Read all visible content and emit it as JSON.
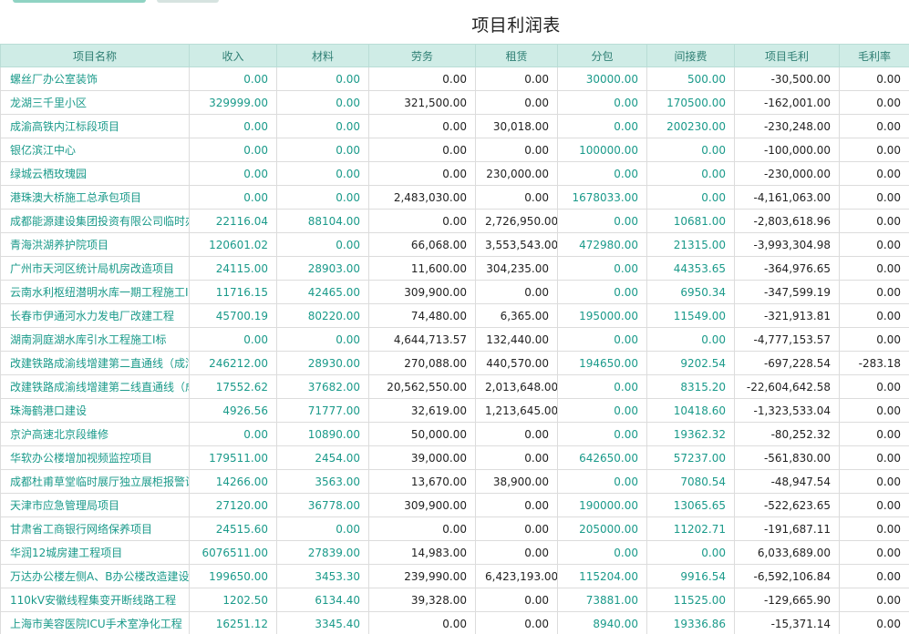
{
  "report": {
    "title": "项目利润表"
  },
  "columns": [
    "项目名称",
    "收入",
    "材料",
    "劳务",
    "租赁",
    "分包",
    "间接费",
    "项目毛利",
    "毛利率"
  ],
  "rows": [
    [
      "螺丝厂办公室装饰",
      "0.00",
      "0.00",
      "0.00",
      "0.00",
      "30000.00",
      "500.00",
      "-30,500.00",
      "0.00"
    ],
    [
      "龙湖三千里小区",
      "329999.00",
      "0.00",
      "321,500.00",
      "0.00",
      "0.00",
      "170500.00",
      "-162,001.00",
      "0.00"
    ],
    [
      "成渝高铁内江标段项目",
      "0.00",
      "0.00",
      "0.00",
      "30,018.00",
      "0.00",
      "200230.00",
      "-230,248.00",
      "0.00"
    ],
    [
      "银亿滨江中心",
      "0.00",
      "0.00",
      "0.00",
      "0.00",
      "100000.00",
      "0.00",
      "-100,000.00",
      "0.00"
    ],
    [
      "绿城云栖玫瑰园",
      "0.00",
      "0.00",
      "0.00",
      "230,000.00",
      "0.00",
      "0.00",
      "-230,000.00",
      "0.00"
    ],
    [
      "港珠澳大桥施工总承包项目",
      "0.00",
      "0.00",
      "2,483,030.00",
      "0.00",
      "1678033.00",
      "0.00",
      "-4,161,063.00",
      "0.00"
    ],
    [
      "成都能源建设集团投资有限公司临时办",
      "22116.04",
      "88104.00",
      "0.00",
      "2,726,950.00",
      "0.00",
      "10681.00",
      "-2,803,618.96",
      "0.00"
    ],
    [
      "青海洪湖养护院项目",
      "120601.02",
      "0.00",
      "66,068.00",
      "3,553,543.00",
      "472980.00",
      "21315.00",
      "-3,993,304.98",
      "0.00"
    ],
    [
      "广州市天河区统计局机房改造项目",
      "24115.00",
      "28903.00",
      "11,600.00",
      "304,235.00",
      "0.00",
      "44353.65",
      "-364,976.65",
      "0.00"
    ],
    [
      "云南水利枢纽潜明水库一期工程施工I",
      "11716.15",
      "42465.00",
      "309,900.00",
      "0.00",
      "0.00",
      "6950.34",
      "-347,599.19",
      "0.00"
    ],
    [
      "长春市伊通河水力发电厂改建工程",
      "45700.19",
      "80220.00",
      "74,480.00",
      "6,365.00",
      "195000.00",
      "11549.00",
      "-321,913.81",
      "0.00"
    ],
    [
      "湖南洞庭湖水库引水工程施工I标",
      "0.00",
      "0.00",
      "4,644,713.57",
      "132,440.00",
      "0.00",
      "0.00",
      "-4,777,153.57",
      "0.00"
    ],
    [
      "改建铁路成渝线增建第二直通线（成渝",
      "246212.00",
      "28930.00",
      "270,088.00",
      "440,570.00",
      "194650.00",
      "9202.54",
      "-697,228.54",
      "-283.18"
    ],
    [
      "改建铁路成渝线增建第二线直通线（成都-",
      "17552.62",
      "37682.00",
      "20,562,550.00",
      "2,013,648.00",
      "0.00",
      "8315.20",
      "-22,604,642.58",
      "0.00"
    ],
    [
      "珠海鹤港口建设",
      "4926.56",
      "71777.00",
      "32,619.00",
      "1,213,645.00",
      "0.00",
      "10418.60",
      "-1,323,533.04",
      "0.00"
    ],
    [
      "京沪高速北京段维修",
      "0.00",
      "10890.00",
      "50,000.00",
      "0.00",
      "0.00",
      "19362.32",
      "-80,252.32",
      "0.00"
    ],
    [
      "华软办公楼增加视频监控项目",
      "179511.00",
      "2454.00",
      "39,000.00",
      "0.00",
      "642650.00",
      "57237.00",
      "-561,830.00",
      "0.00"
    ],
    [
      "成都杜甫草堂临时展厅独立展柜报警设",
      "14266.00",
      "3563.00",
      "13,670.00",
      "38,900.00",
      "0.00",
      "7080.54",
      "-48,947.54",
      "0.00"
    ],
    [
      "天津市应急管理局项目",
      "27120.00",
      "36778.00",
      "309,900.00",
      "0.00",
      "190000.00",
      "13065.65",
      "-522,623.65",
      "0.00"
    ],
    [
      "甘肃省工商银行网络保养项目",
      "24515.60",
      "0.00",
      "0.00",
      "0.00",
      "205000.00",
      "11202.71",
      "-191,687.11",
      "0.00"
    ],
    [
      "华润12城房建工程项目",
      "6076511.00",
      "27839.00",
      "14,983.00",
      "0.00",
      "0.00",
      "0.00",
      "6,033,689.00",
      "0.00"
    ],
    [
      "万达办公楼左侧A、B办公楼改造建设",
      "199650.00",
      "3453.30",
      "239,990.00",
      "6,423,193.00",
      "115204.00",
      "9916.54",
      "-6,592,106.84",
      "0.00"
    ],
    [
      "110kV安徽线程集变开断线路工程",
      "1202.50",
      "6134.40",
      "39,328.00",
      "0.00",
      "73881.00",
      "11525.00",
      "-129,665.90",
      "0.00"
    ],
    [
      "上海市美容医院ICU手术室净化工程",
      "16251.12",
      "3345.40",
      "0.00",
      "0.00",
      "8940.00",
      "19336.86",
      "-15,371.14",
      "0.00"
    ]
  ]
}
